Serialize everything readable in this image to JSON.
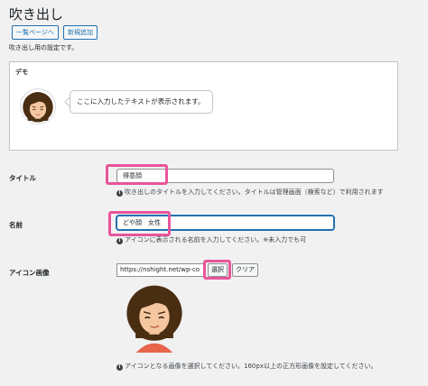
{
  "page": {
    "title": "吹き出し",
    "back_button": "一覧ページへ",
    "add_button": "新規追加",
    "description": "吹き出し用の設定です。"
  },
  "demo": {
    "label": "デモ",
    "bubble_text": "ここに入力したテキストが表示されます。"
  },
  "fields": {
    "title": {
      "label": "タイトル",
      "value": "得意顔",
      "help": "吹き出しのタイトルを入力してください。タイトルは管理画面（検索など）で利用されます"
    },
    "name": {
      "label": "名前",
      "value": "どや顔　女性",
      "help": "アイコンに表示される名前を入力してください。※未入力でも可"
    },
    "icon_image": {
      "label": "アイコン画像",
      "url_value": "https://nshight.net/wp-co",
      "select_button": "選択",
      "clear_button": "クリア",
      "help": "アイコンとなる画像を選択してください。160px以上の正方形画像を設定してください。"
    }
  },
  "colors": {
    "highlight": "#e8559a",
    "link": "#2271b1"
  }
}
